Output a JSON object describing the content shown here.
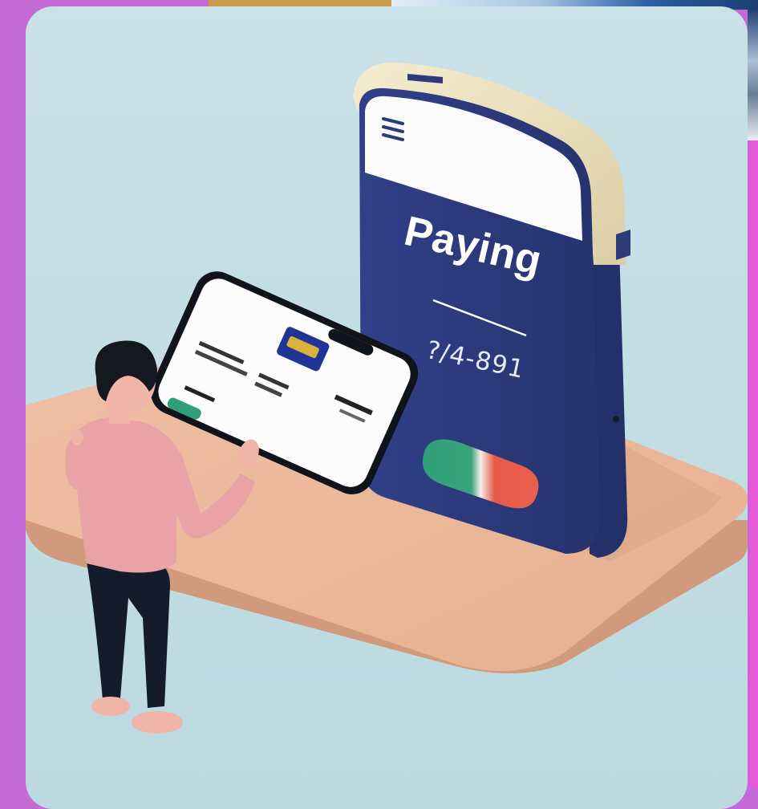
{
  "scene": {
    "kiosk_label": "Paying",
    "kiosk_number": "?/4-891"
  },
  "colors": {
    "frame": "#c46ad6",
    "card_background": "#c5dfe5",
    "kiosk_body": "#2e3b7a",
    "kiosk_trim": "#ede1be",
    "platform": "#e8b598",
    "shirt": "#e9a3a7",
    "pants": "#141c2c",
    "button_green": "#2f9f7a",
    "button_red": "#e65a48"
  },
  "icons": {
    "menu": "hamburger-menu-icon"
  }
}
